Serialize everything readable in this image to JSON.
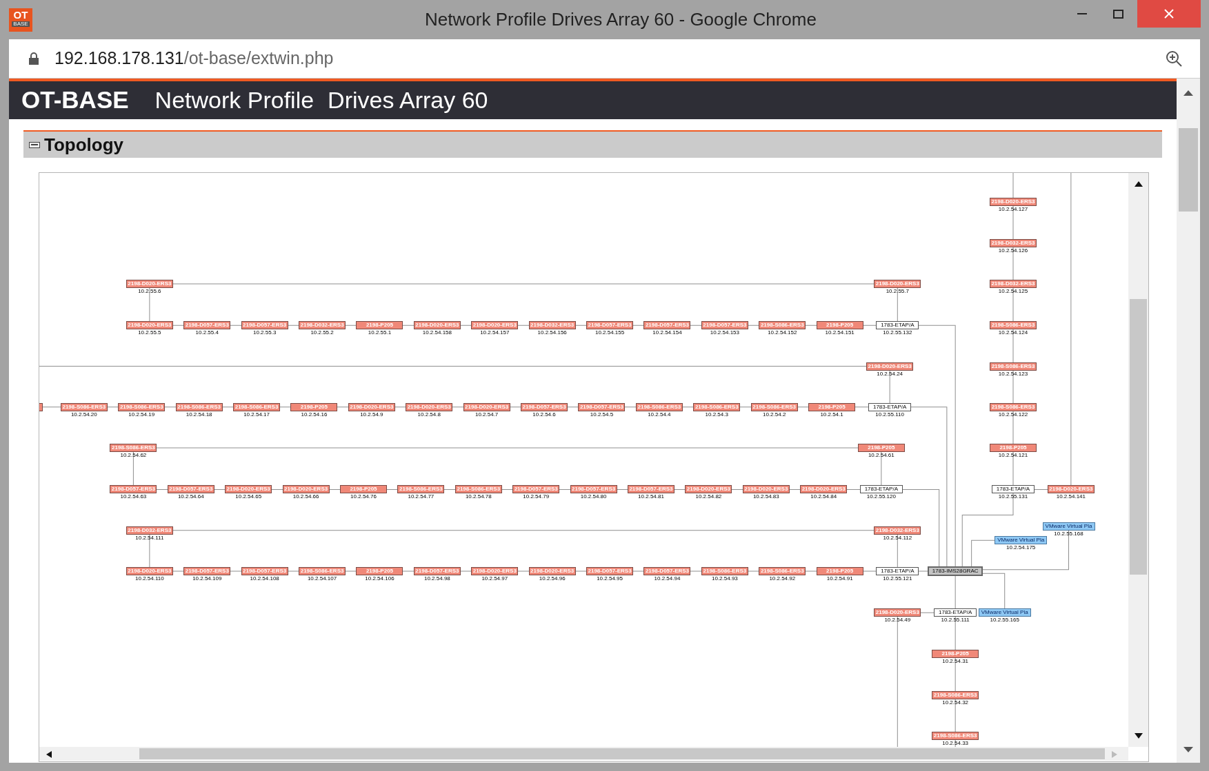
{
  "window": {
    "title": "Network Profile Drives Array 60 - Google Chrome",
    "app_icon_top": "OT",
    "app_icon_bottom": "BASE"
  },
  "address_bar": {
    "host": "192.168.178.131",
    "path": "/ot-base/extwin.php"
  },
  "header": {
    "logo": "OT-BASE",
    "title": "Network Profile",
    "subtitle": "Drives Array 60"
  },
  "section": {
    "title": "Topology",
    "expanded": true
  },
  "topology": {
    "nodes": [
      {
        "kind": "drive",
        "label": "2198-D020-ERS3",
        "ip": "10.2.54.127"
      },
      {
        "kind": "drive",
        "label": "2198-D032-ERS3",
        "ip": "10.2.54.126"
      },
      {
        "kind": "drive",
        "label": "2198-D020-ERS3",
        "ip": "10.2.55.6"
      },
      {
        "kind": "drive",
        "label": "2198-D020-ERS3",
        "ip": "10.2.55.7"
      },
      {
        "kind": "drive",
        "label": "2198-D032-ERS3",
        "ip": "10.2.54.125"
      },
      {
        "kind": "drive",
        "label": "2198-D020-ERS3",
        "ip": "10.2.55.5"
      },
      {
        "kind": "drive",
        "label": "2198-D057-ERS3",
        "ip": "10.2.55.4"
      },
      {
        "kind": "drive",
        "label": "2198-D057-ERS3",
        "ip": "10.2.55.3"
      },
      {
        "kind": "drive",
        "label": "2198-D032-ERS3",
        "ip": "10.2.55.2"
      },
      {
        "kind": "drive",
        "label": "2198-P205",
        "ip": "10.2.55.1"
      },
      {
        "kind": "drive",
        "label": "2198-D020-ERS3",
        "ip": "10.2.54.158"
      },
      {
        "kind": "drive",
        "label": "2198-D020-ERS3",
        "ip": "10.2.54.157"
      },
      {
        "kind": "drive",
        "label": "2198-D032-ERS3",
        "ip": "10.2.54.156"
      },
      {
        "kind": "drive",
        "label": "2198-D057-ERS3",
        "ip": "10.2.54.155"
      },
      {
        "kind": "drive",
        "label": "2198-D057-ERS3",
        "ip": "10.2.54.154"
      },
      {
        "kind": "drive",
        "label": "2198-D057-ERS3",
        "ip": "10.2.54.153"
      },
      {
        "kind": "drive",
        "label": "2198-S086-ERS3",
        "ip": "10.2.54.152"
      },
      {
        "kind": "drive",
        "label": "2198-P205",
        "ip": "10.2.54.151"
      },
      {
        "kind": "adapter",
        "label": "1783-ETAP/A",
        "ip": "10.2.55.132"
      },
      {
        "kind": "drive",
        "label": "2198-S086-ERS3",
        "ip": "10.2.54.124"
      },
      {
        "kind": "drive",
        "label": "2198-D020-ERS3",
        "ip": "10.2.54.24"
      },
      {
        "kind": "drive",
        "label": "2198-S086-ERS3",
        "ip": "10.2.54.123"
      },
      {
        "kind": "drive_cut"
      },
      {
        "kind": "drive",
        "label": "2198-S086-ERS3",
        "ip": "10.2.54.20"
      },
      {
        "kind": "drive",
        "label": "2198-S086-ERS3",
        "ip": "10.2.54.19"
      },
      {
        "kind": "drive",
        "label": "2198-S086-ERS3",
        "ip": "10.2.54.18"
      },
      {
        "kind": "drive",
        "label": "2198-S086-ERS3",
        "ip": "10.2.54.17"
      },
      {
        "kind": "drive",
        "label": "2198-P205",
        "ip": "10.2.54.16"
      },
      {
        "kind": "drive",
        "label": "2198-D020-ERS3",
        "ip": "10.2.54.9"
      },
      {
        "kind": "drive",
        "label": "2198-D020-ERS3",
        "ip": "10.2.54.8"
      },
      {
        "kind": "drive",
        "label": "2198-D020-ERS3",
        "ip": "10.2.54.7"
      },
      {
        "kind": "drive",
        "label": "2198-D057-ERS3",
        "ip": "10.2.54.6"
      },
      {
        "kind": "drive",
        "label": "2198-D057-ERS3",
        "ip": "10.2.54.5"
      },
      {
        "kind": "drive",
        "label": "2198-S086-ERS3",
        "ip": "10.2.54.4"
      },
      {
        "kind": "drive",
        "label": "2198-S086-ERS3",
        "ip": "10.2.54.3"
      },
      {
        "kind": "drive",
        "label": "2198-S086-ERS3",
        "ip": "10.2.54.2"
      },
      {
        "kind": "drive",
        "label": "2198-P205",
        "ip": "10.2.54.1"
      },
      {
        "kind": "adapter",
        "label": "1783-ETAP/A",
        "ip": "10.2.55.110"
      },
      {
        "kind": "drive",
        "label": "2198-S086-ERS3",
        "ip": "10.2.54.122"
      },
      {
        "kind": "drive",
        "label": "2198-S086-ERS3",
        "ip": "10.2.54.62"
      },
      {
        "kind": "drive",
        "label": "2198-P205",
        "ip": "10.2.54.61"
      },
      {
        "kind": "drive",
        "label": "2198-P205",
        "ip": "10.2.54.121"
      },
      {
        "kind": "drive",
        "label": "2198-D057-ERS3",
        "ip": "10.2.54.63"
      },
      {
        "kind": "drive",
        "label": "2198-D057-ERS3",
        "ip": "10.2.54.64"
      },
      {
        "kind": "drive",
        "label": "2198-D020-ERS3",
        "ip": "10.2.54.65"
      },
      {
        "kind": "drive",
        "label": "2198-D020-ERS3",
        "ip": "10.2.54.66"
      },
      {
        "kind": "drive",
        "label": "2198-P205",
        "ip": "10.2.54.76"
      },
      {
        "kind": "drive",
        "label": "2198-S086-ERS3",
        "ip": "10.2.54.77"
      },
      {
        "kind": "drive",
        "label": "2198-S086-ERS3",
        "ip": "10.2.54.78"
      },
      {
        "kind": "drive",
        "label": "2198-D057-ERS3",
        "ip": "10.2.54.79"
      },
      {
        "kind": "drive",
        "label": "2198-D057-ERS3",
        "ip": "10.2.54.80"
      },
      {
        "kind": "drive",
        "label": "2198-D057-ERS3",
        "ip": "10.2.54.81"
      },
      {
        "kind": "drive",
        "label": "2198-D020-ERS3",
        "ip": "10.2.54.82"
      },
      {
        "kind": "drive",
        "label": "2198-D020-ERS3",
        "ip": "10.2.54.83"
      },
      {
        "kind": "drive",
        "label": "2198-D020-ERS3",
        "ip": "10.2.54.84"
      },
      {
        "kind": "adapter",
        "label": "1783-ETAP/A",
        "ip": "10.2.55.120"
      },
      {
        "kind": "adapter",
        "label": "1783-ETAP/A",
        "ip": "10.2.55.131"
      },
      {
        "kind": "drive",
        "label": "2198-D020-ERS3",
        "ip": "10.2.54.141"
      },
      {
        "kind": "drive",
        "label": "2198-D032-ERS3",
        "ip": "10.2.54.111"
      },
      {
        "kind": "drive",
        "label": "2198-D032-ERS3",
        "ip": "10.2.54.112"
      },
      {
        "kind": "vm",
        "label": "VMware Virtual Pla",
        "ip": "10.2.55.168"
      },
      {
        "kind": "vm",
        "label": "VMware Virtual Pla",
        "ip": "10.2.54.175"
      },
      {
        "kind": "drive",
        "label": "2198-D020-ERS3",
        "ip": "10.2.54.110"
      },
      {
        "kind": "drive",
        "label": "2198-D057-ERS3",
        "ip": "10.2.54.109"
      },
      {
        "kind": "drive",
        "label": "2198-D057-ERS3",
        "ip": "10.2.54.108"
      },
      {
        "kind": "drive",
        "label": "2198-S086-ERS3",
        "ip": "10.2.54.107"
      },
      {
        "kind": "drive",
        "label": "2198-P205",
        "ip": "10.2.54.106"
      },
      {
        "kind": "drive",
        "label": "2198-D057-ERS3",
        "ip": "10.2.54.98"
      },
      {
        "kind": "drive",
        "label": "2198-D020-ERS3",
        "ip": "10.2.54.97"
      },
      {
        "kind": "drive",
        "label": "2198-D020-ERS3",
        "ip": "10.2.54.96"
      },
      {
        "kind": "drive",
        "label": "2198-D057-ERS3",
        "ip": "10.2.54.95"
      },
      {
        "kind": "drive",
        "label": "2198-D057-ERS3",
        "ip": "10.2.54.94"
      },
      {
        "kind": "drive",
        "label": "2198-S086-ERS3",
        "ip": "10.2.54.93"
      },
      {
        "kind": "drive",
        "label": "2198-S086-ERS3",
        "ip": "10.2.54.92"
      },
      {
        "kind": "drive",
        "label": "2198-P205",
        "ip": "10.2.54.91"
      },
      {
        "kind": "adapter",
        "label": "1783-ETAP/A",
        "ip": "10.2.55.121"
      },
      {
        "kind": "switch",
        "label": "1783-IMS28GRAC"
      },
      {
        "kind": "drive",
        "label": "2198-D020-ERS3",
        "ip": "10.2.54.49"
      },
      {
        "kind": "adapter",
        "label": "1783-ETAP/A",
        "ip": "10.2.55.111"
      },
      {
        "kind": "vm",
        "label": "VMware Virtual Pla",
        "ip": "10.2.55.165"
      },
      {
        "kind": "drive",
        "label": "2198-P205",
        "ip": "10.2.54.31"
      },
      {
        "kind": "drive",
        "label": "2198-S086-ERS3",
        "ip": "10.2.54.32"
      },
      {
        "kind": "drive",
        "label": "2198-S086-ERS3",
        "ip": "10.2.54.33"
      }
    ]
  }
}
